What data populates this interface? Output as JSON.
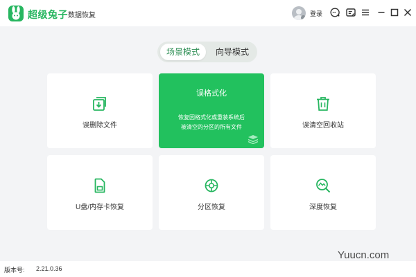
{
  "titlebar": {
    "app_name": "超级兔子",
    "app_subtitle": "数据恢复",
    "login_label": "登录",
    "accent_color": "#22c15e"
  },
  "modes": {
    "tabs": [
      {
        "label": "场景模式",
        "active": true
      },
      {
        "label": "向导模式",
        "active": false
      }
    ]
  },
  "cards": [
    {
      "label": "误删除文件",
      "icon": "file-restore-icon"
    },
    {
      "title": "误格式化",
      "desc_line1": "恢复因格式化或重装系统后",
      "desc_line2": "被清空的分区的所有文件",
      "icon": "layers-icon",
      "active": true
    },
    {
      "label": "误清空回收站",
      "icon": "recycle-bin-icon"
    },
    {
      "label": "U盘/内存卡恢复",
      "icon": "sd-card-icon"
    },
    {
      "label": "分区恢复",
      "icon": "partition-icon"
    },
    {
      "label": "深度恢复",
      "icon": "deep-scan-icon"
    }
  ],
  "statusbar": {
    "version_label": "版本号:",
    "version_value": "2.21.0.36"
  },
  "watermark": "Yuucn.com"
}
